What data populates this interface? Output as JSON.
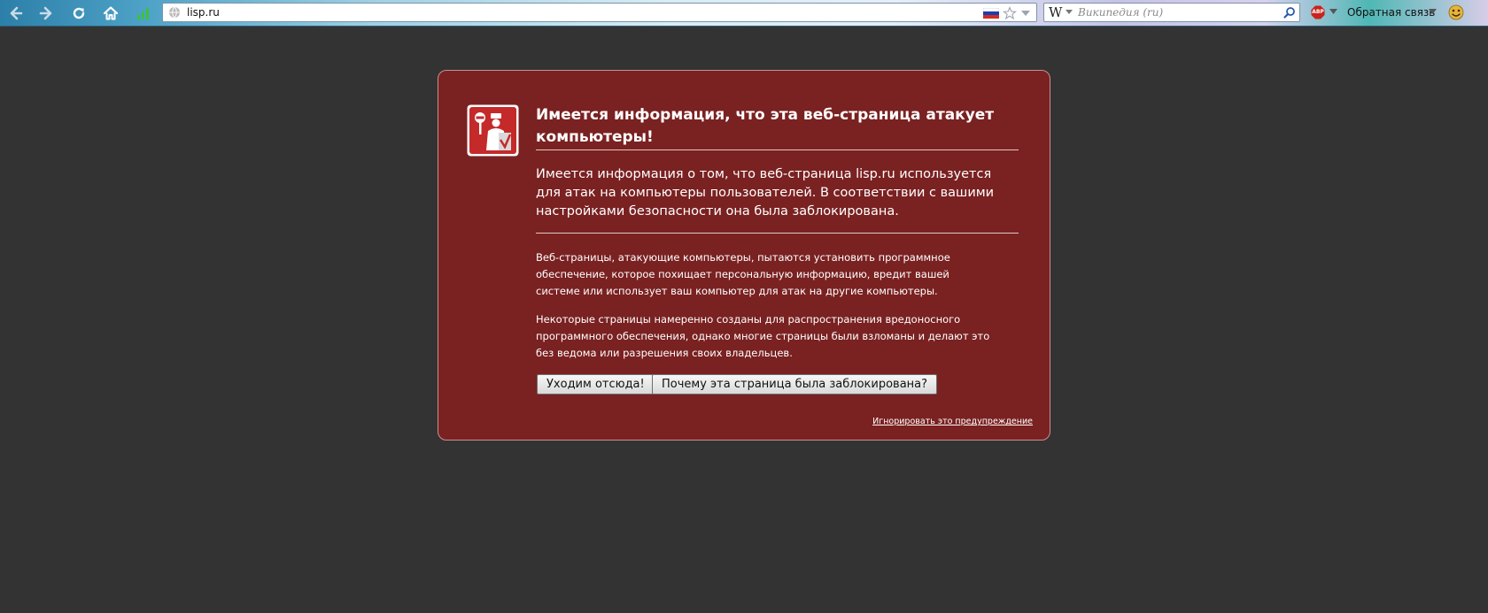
{
  "toolbar": {
    "url": "lisp.ru",
    "search_placeholder": "Википедия (ru)",
    "feedback_label": "Обратная связь",
    "adblock_badge": "ABP",
    "search_engine_letter": "W",
    "icons": [
      "back-icon",
      "forward-icon",
      "reload-icon",
      "home-icon",
      "signal-icon",
      "globe-icon",
      "russia-flag-icon",
      "star-icon",
      "dropdown-arrow-icon",
      "wikipedia-icon",
      "search-icon",
      "adblock-icon",
      "smiley-icon"
    ]
  },
  "warning": {
    "title": "Имеется информация, что эта веб-страница атакует компьютеры!",
    "lead": "Имеется информация о том, что веб-страница lisp.ru используется для атак на компьютеры пользователей. В соответствии с вашими настройками безопасности она была заблокирована.",
    "paragraph1": "Веб-страницы, атакующие компьютеры, пытаются установить программное обеспечение, которое похищает персональную информацию, вредит вашей системе или использует ваш компьютер для атак на другие компьютеры.",
    "paragraph2": "Некоторые страницы намеренно созданы для распространения вредоносного программного обеспечения, однако многие страницы были взломаны и делают это без ведома или разрешения своих владельцев.",
    "get_out_button": "Уходим отсюда!",
    "why_blocked_button": "Почему эта страница была заблокирована?",
    "ignore_link": "Игнорировать это предупреждение"
  },
  "colors": {
    "page_bg": "#333333",
    "panel_bg": "#7a2121",
    "panel_border": "#c79090",
    "text": "#ffffff"
  }
}
